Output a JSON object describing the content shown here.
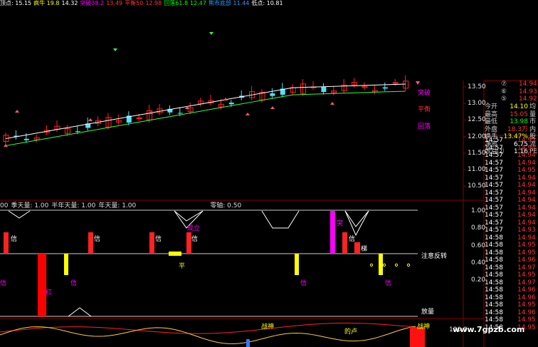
{
  "top_bar": {
    "items": [
      {
        "label": "顶点: 15.15",
        "color": "#ffffff"
      },
      {
        "label": "疯牛 19.8",
        "color": "#ffff00"
      },
      {
        "label": "14.32",
        "color": "#ffffff"
      },
      {
        "label": "突破38.2",
        "color": "#ff00ff"
      },
      {
        "label": "13.49",
        "color": "#ff3333"
      },
      {
        "label": "平衡50",
        "color": "#ff3333"
      },
      {
        "label": "12.98",
        "color": "#ff3333"
      },
      {
        "label": "回落61.8",
        "color": "#00ff00"
      },
      {
        "label": "12.47",
        "color": "#00ff00"
      },
      {
        "label": "熊市底部 11.44",
        "color": "#3399ff"
      },
      {
        "label": "低点: 10.81",
        "color": "#ffffff"
      }
    ]
  },
  "main_chart": {
    "labels": {
      "tupo": "突破",
      "pingheng": "平衡",
      "huiluo": "回落"
    },
    "y_ticks": [
      "13.50",
      "13.00",
      "12.50",
      "12.00",
      "11.50",
      "11.00",
      "10.50"
    ],
    "colors": {
      "up": "#ff2222",
      "down": "#55e0ff",
      "ma1": "#ffffff",
      "ma2": "#33ff33",
      "ma3": "#ffff00"
    }
  },
  "mid_bar": {
    "items": [
      "00",
      "季天量: 1.00",
      "半年天量: 1.00",
      "年天量: 1.00",
      "零轴: 0.50"
    ]
  },
  "indicator": {
    "y_ticks": [
      "1.00",
      "0.80",
      "0.60",
      "0.40",
      "0.20"
    ],
    "labels": {
      "chengli": "成立",
      "xin": "信",
      "tupo": "突",
      "ti": "梯",
      "ping": "平",
      "hong": "红",
      "zhuyi": "注意反转",
      "fangliang": "放量"
    }
  },
  "bottom": {
    "labels": {
      "zhanshen": "战神",
      "dehu": "的卢",
      "tail": "战神"
    },
    "y_ticks": [
      "100.0"
    ]
  },
  "quote": {
    "rows": [
      {
        "key": "今开",
        "val": "14.10",
        "vcolor": "#ffff00",
        "tail": "均"
      },
      {
        "key": "最高",
        "val": "15.05",
        "vcolor": "#ff3333",
        "tail": "量"
      },
      {
        "key": "最低",
        "val": "13.98",
        "vcolor": "#00ff00",
        "tail": "市"
      },
      {
        "key": "外盘",
        "val": "18.3万",
        "vcolor": "#ff3333",
        "tail": "内"
      },
      {
        "key": "换手",
        "val": "13.47%",
        "vcolor": "#ffff00",
        "tail": "股"
      },
      {
        "key": "净资",
        "val": "6.75",
        "vcolor": "#ffffff",
        "tail": "流"
      },
      {
        "key": "收益⑵",
        "val": "1.16",
        "vcolor": "#ffffff",
        "tail": "PE"
      }
    ]
  },
  "order_book": [
    {
      "n": "⑦",
      "price": "14.94"
    },
    {
      "n": "⑥",
      "price": "14.93"
    },
    {
      "n": "⑤",
      "price": "14.92"
    }
  ],
  "trades": [
    {
      "t": "14:57",
      "p": "14.95"
    },
    {
      "t": "14:57",
      "p": "14.94"
    },
    {
      "t": "14:57",
      "p": "14.94"
    },
    {
      "t": "14:57",
      "p": "14.94"
    },
    {
      "t": "14:57",
      "p": "14.95"
    },
    {
      "t": "14:57",
      "p": "14.94"
    },
    {
      "t": "14:57",
      "p": "14.94"
    },
    {
      "t": "14:57",
      "p": "14.94"
    },
    {
      "t": "14:57",
      "p": "14.94"
    },
    {
      "t": "14:57",
      "p": "14.94"
    },
    {
      "t": "14:57",
      "p": "14.94"
    },
    {
      "t": "14:57",
      "p": "14.94"
    },
    {
      "t": "14:57",
      "p": "14.93"
    },
    {
      "t": "14:58",
      "p": "14.94"
    },
    {
      "t": "14:58",
      "p": "14.95"
    },
    {
      "t": "14:58",
      "p": "14.95"
    },
    {
      "t": "14:58",
      "p": "14.96"
    },
    {
      "t": "14:58",
      "p": "14.97"
    },
    {
      "t": "14:58",
      "p": "14.95"
    },
    {
      "t": "14:58",
      "p": "14.97"
    },
    {
      "t": "14:58",
      "p": "14.96"
    },
    {
      "t": "14:58",
      "p": "14.96"
    },
    {
      "t": "14:58",
      "p": "14.95"
    },
    {
      "t": "14:58",
      "p": "14.96"
    },
    {
      "t": "14:58",
      "p": "14.95"
    },
    {
      "t": "14:58",
      "p": "14.95"
    }
  ],
  "watermark": "www.7gpzb.com"
}
